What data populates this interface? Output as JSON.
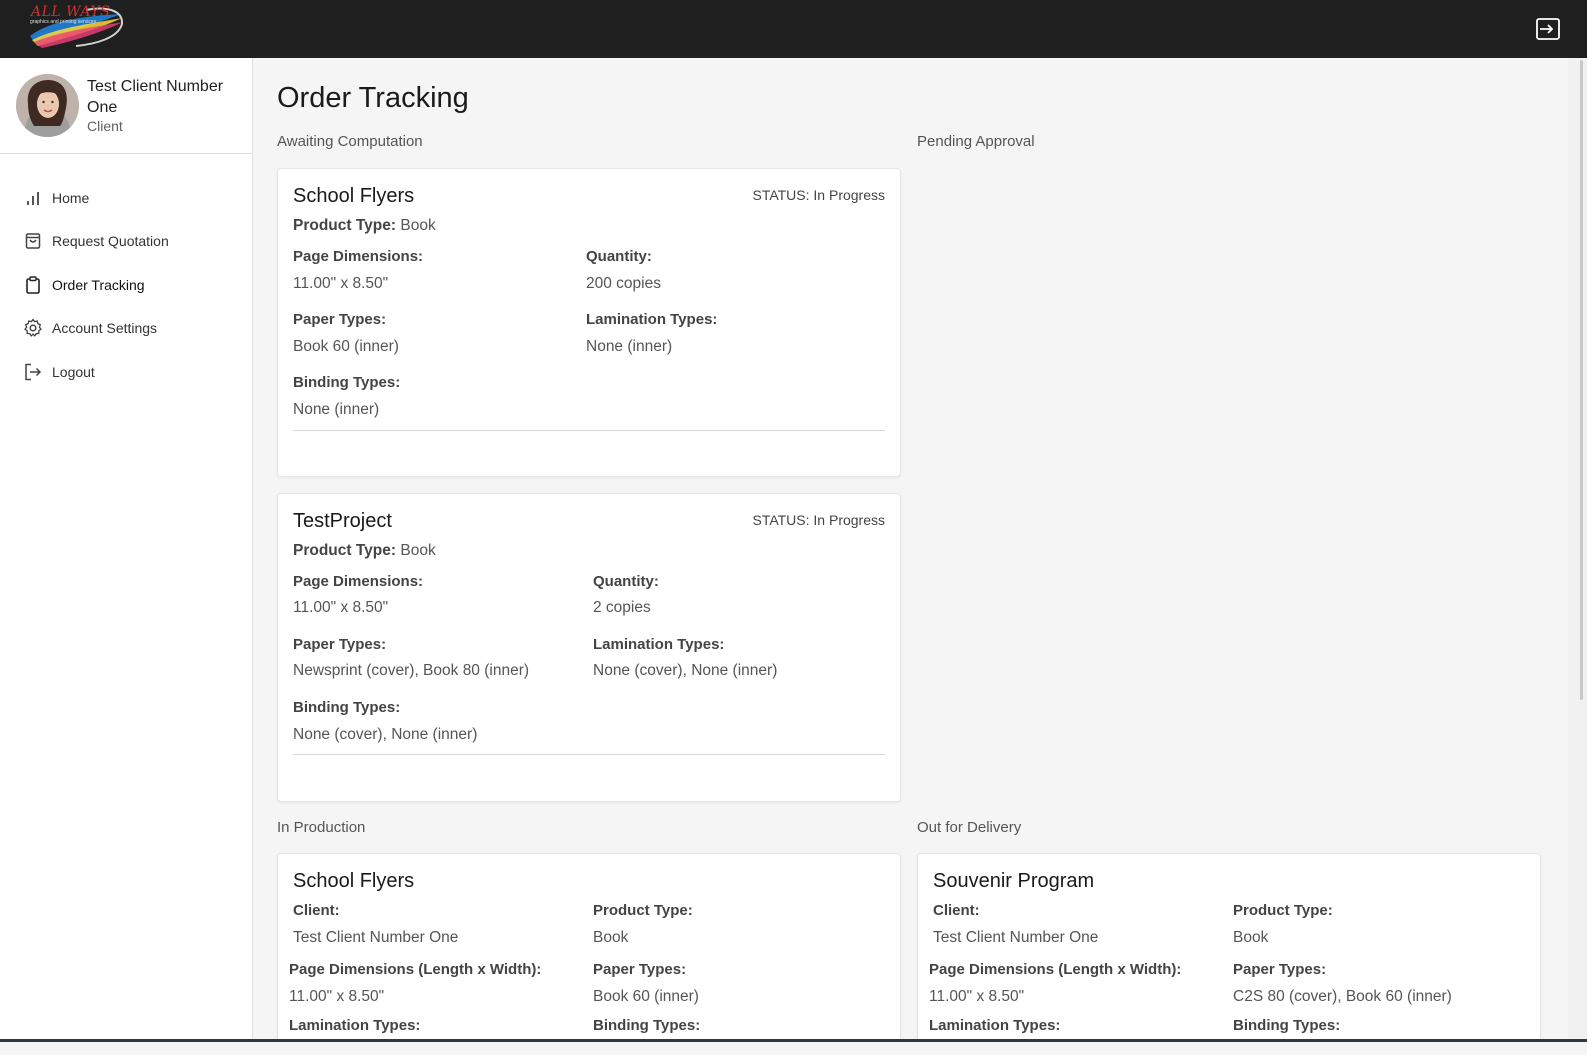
{
  "app": {
    "logo_text": "ALL WAYS",
    "logo_subtitle": "graphics and printing services",
    "accent": "#d32f2f",
    "topbar_color": "#1f1f1f"
  },
  "user": {
    "name": "Test Client Number One",
    "role": "Client"
  },
  "nav": {
    "items": [
      {
        "label": "Home",
        "icon": "bar-chart-icon"
      },
      {
        "label": "Request Quotation",
        "icon": "shopping-bag-icon"
      },
      {
        "label": "Order Tracking",
        "icon": "clipboard-icon",
        "active": true
      },
      {
        "label": "Account Settings",
        "icon": "gear-icon"
      },
      {
        "label": "Logout",
        "icon": "logout-icon"
      }
    ]
  },
  "page": {
    "title": "Order Tracking",
    "columns": {
      "awaiting": "Awaiting Computation",
      "pending": "Pending Approval",
      "production": "In Production",
      "delivery": "Out for Delivery"
    }
  },
  "awaiting_orders": [
    {
      "title": "School Flyers",
      "status": "STATUS: In Progress",
      "product_type_label": "Product Type:",
      "product_type": "Book",
      "page_dimensions_label": "Page Dimensions:",
      "page_dimensions": "11.00\" x 8.50\"",
      "quantity_label": "Quantity:",
      "quantity": "200 copies",
      "paper_types_label": "Paper Types:",
      "paper_types": "Book 60 (inner)",
      "lamination_types_label": "Lamination Types:",
      "lamination_types": "None (inner)",
      "binding_types_label": "Binding Types:",
      "binding_types": "None (inner)"
    },
    {
      "title": "TestProject",
      "status": "STATUS: In Progress",
      "product_type_label": "Product Type:",
      "product_type": "Book",
      "page_dimensions_label": "Page Dimensions:",
      "page_dimensions": "11.00\" x 8.50\"",
      "quantity_label": "Quantity:",
      "quantity": "2 copies",
      "paper_types_label": "Paper Types:",
      "paper_types": "Newsprint (cover), Book 80 (inner)",
      "lamination_types_label": "Lamination Types:",
      "lamination_types": "None (cover), None (inner)",
      "binding_types_label": "Binding Types:",
      "binding_types": "None (cover), None (inner)"
    }
  ],
  "production_orders": [
    {
      "title": "School Flyers",
      "client_label": "Client:",
      "client": "Test Client Number One",
      "product_type_label": "Product Type:",
      "product_type": "Book",
      "page_dimensions_label": "Page Dimensions (Length x Width):",
      "page_dimensions": "11.00\" x 8.50\"",
      "paper_types_label": "Paper Types:",
      "paper_types": "Book 60 (inner)",
      "lamination_types_label": "Lamination Types:",
      "binding_types_label": "Binding Types:"
    }
  ],
  "delivery_orders": [
    {
      "title": "Souvenir Program",
      "client_label": "Client:",
      "client": "Test Client Number One",
      "product_type_label": "Product Type:",
      "product_type": "Book",
      "page_dimensions_label": "Page Dimensions (Length x Width):",
      "page_dimensions": "11.00\" x 8.50\"",
      "paper_types_label": "Paper Types:",
      "paper_types": "C2S 80 (cover), Book 60 (inner)",
      "lamination_types_label": "Lamination Types:",
      "binding_types_label": "Binding Types:"
    }
  ]
}
